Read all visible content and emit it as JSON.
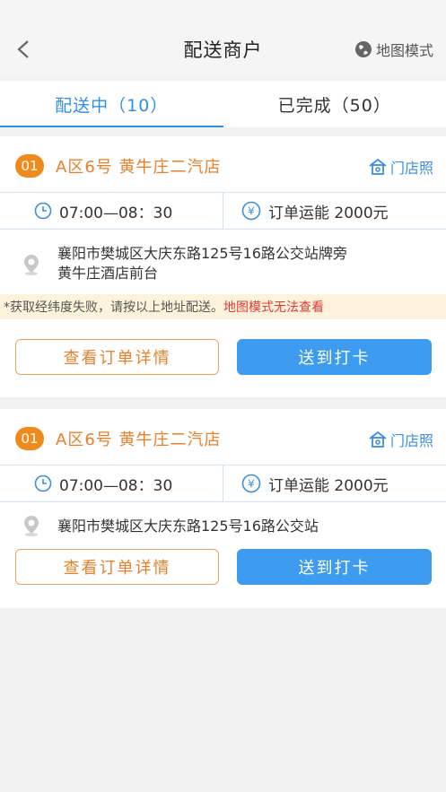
{
  "header": {
    "title": "配送商户",
    "map_mode_label": "地图模式"
  },
  "tabs": [
    {
      "label": "配送中（10）",
      "active": true
    },
    {
      "label": "已完成（50）",
      "active": false
    }
  ],
  "orders": [
    {
      "index": "01",
      "store_name": "A区6号 黄牛庄二汽店",
      "store_photo_label": "门店照",
      "time": "07:00—08：30",
      "fee": "订单运能  2000元",
      "address_line1": "襄阳市樊城区大庆东路125号16路公交站牌旁",
      "address_line2": "黄牛庄酒店前台",
      "notice_text": "*获取经纬度失败，请按以上地址配送。",
      "notice_red": "地图模式无法查看",
      "detail_button": "查看订单详情",
      "checkin_button": "送到打卡"
    },
    {
      "index": "01",
      "store_name": "A区6号 黄牛庄二汽店",
      "store_photo_label": "门店照",
      "time": "07:00—08：30",
      "fee": "订单运能  2000元",
      "address_line1": "襄阳市樊城区大庆东路125号16路公交站",
      "detail_button": "查看订单详情",
      "checkin_button": "送到打卡"
    }
  ],
  "colors": {
    "accent": "#2e8fe6",
    "orange": "#e8802a",
    "notice_bg": "#fdf3dc",
    "notice_red": "#e53935"
  }
}
